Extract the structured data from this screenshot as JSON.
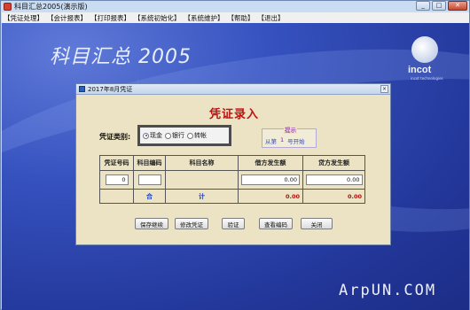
{
  "window": {
    "title": "科目汇总2005(演示版)",
    "minimize": "_",
    "maximize": "□",
    "close": "✕"
  },
  "menu": [
    "【凭证处理】",
    "【会计报表】",
    "【打印报表】",
    "【系统初始化】",
    "【系统维护】",
    "【帮助】",
    "【退出】"
  ],
  "workspace": {
    "brand_title": "科目汇总 2005",
    "logo_text": "incot",
    "logo_sub": "incot technologies",
    "watermark": "ArpUN.COM"
  },
  "dialog": {
    "title": "2017年8月凭证",
    "close": "×",
    "heading": "凭证录入",
    "voucher_type_label": "凭证类别:",
    "voucher_types": [
      {
        "label": "现金",
        "selected": true
      },
      {
        "label": "银行",
        "selected": false
      },
      {
        "label": "转帐",
        "selected": false
      }
    ],
    "hint": {
      "title": "提示",
      "prefix": "从第",
      "number": "1",
      "suffix": "号开始"
    },
    "table": {
      "headers": [
        "凭证号码",
        "科目编码",
        "科目名称",
        "借方发生额",
        "贷方发生额"
      ],
      "row": {
        "voucher_no": "0",
        "account_code": "",
        "account_name": "",
        "debit": "0.00",
        "credit": "0.00"
      },
      "total": {
        "label_1": "合",
        "label_2": "计",
        "debit": "0.00",
        "credit": "0.00"
      }
    },
    "buttons": [
      "保存继续",
      "修改凭证",
      "验证",
      "查看编码",
      "关闭"
    ]
  }
}
